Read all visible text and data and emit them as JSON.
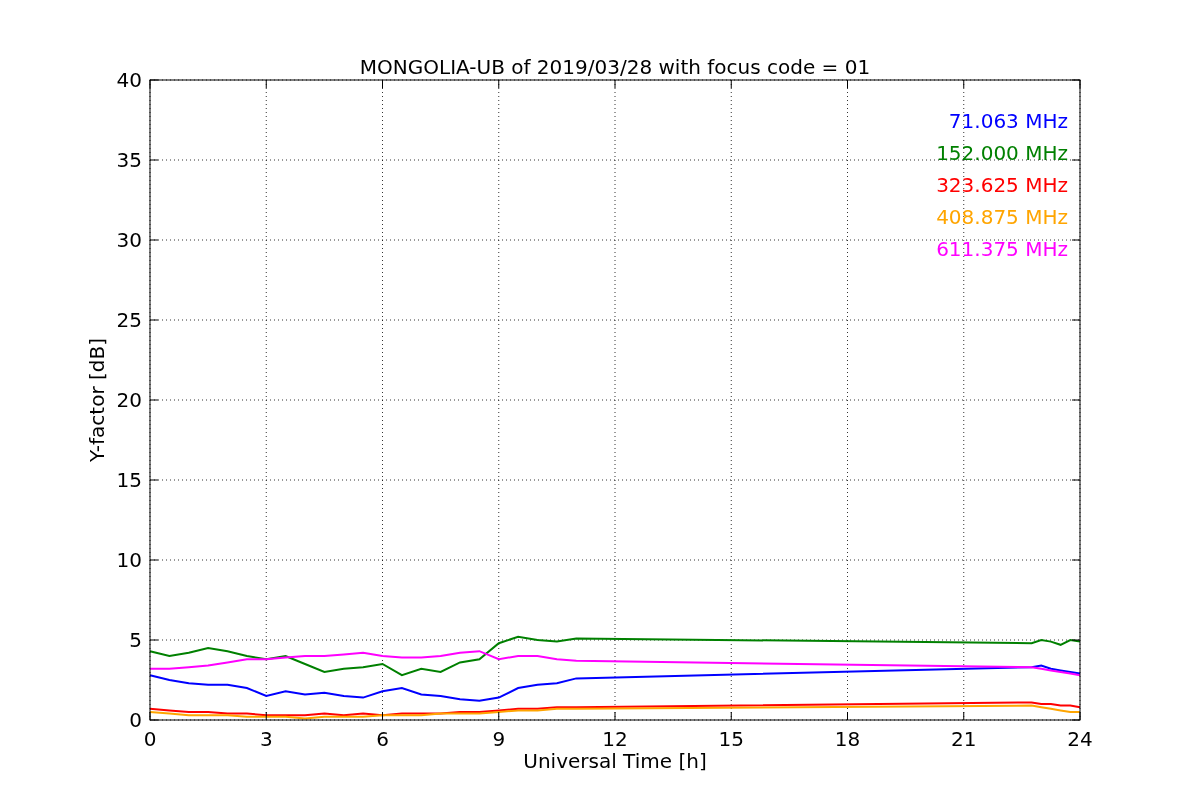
{
  "figure": {
    "chart_data": {
      "type": "line",
      "title": "MONGOLIA-UB of 2019/03/28 with focus code = 01",
      "xlabel": "Universal Time [h]",
      "ylabel": "Y-factor [dB]",
      "x": [
        0,
        0.5,
        1,
        1.5,
        2,
        2.5,
        3,
        3.5,
        4,
        4.5,
        5,
        5.5,
        6,
        6.5,
        7,
        7.5,
        8,
        8.5,
        9,
        9.5,
        10,
        10.5,
        11,
        22.75,
        23,
        23.25,
        23.5,
        23.75,
        24
      ],
      "series": [
        {
          "name": "71.063 MHz",
          "color": "#0000ff",
          "values": [
            2.8,
            2.5,
            2.3,
            2.2,
            2.2,
            2.0,
            1.5,
            1.8,
            1.6,
            1.7,
            1.5,
            1.4,
            1.8,
            2.0,
            1.6,
            1.5,
            1.3,
            1.2,
            1.4,
            2.0,
            2.2,
            2.3,
            2.6,
            3.3,
            3.4,
            3.2,
            3.1,
            3.0,
            2.9
          ]
        },
        {
          "name": "152.000 MHz",
          "color": "#008000",
          "values": [
            4.3,
            4.0,
            4.2,
            4.5,
            4.3,
            4.0,
            3.8,
            4.0,
            3.5,
            3.0,
            3.2,
            3.3,
            3.5,
            2.8,
            3.2,
            3.0,
            3.6,
            3.8,
            4.8,
            5.2,
            5.0,
            4.9,
            5.1,
            4.8,
            5.0,
            4.9,
            4.7,
            5.0,
            4.9
          ]
        },
        {
          "name": "323.625 MHz",
          "color": "#ff0000",
          "values": [
            0.7,
            0.6,
            0.5,
            0.5,
            0.4,
            0.4,
            0.3,
            0.3,
            0.3,
            0.4,
            0.3,
            0.4,
            0.3,
            0.4,
            0.4,
            0.4,
            0.5,
            0.5,
            0.6,
            0.7,
            0.7,
            0.8,
            0.8,
            1.1,
            1.0,
            1.0,
            0.9,
            0.9,
            0.8
          ]
        },
        {
          "name": "408.875 MHz",
          "color": "#ffa500",
          "values": [
            0.5,
            0.4,
            0.3,
            0.3,
            0.3,
            0.2,
            0.2,
            0.2,
            0.1,
            0.2,
            0.2,
            0.2,
            0.3,
            0.3,
            0.3,
            0.4,
            0.4,
            0.4,
            0.5,
            0.6,
            0.6,
            0.7,
            0.7,
            0.9,
            0.8,
            0.7,
            0.6,
            0.5,
            0.5
          ]
        },
        {
          "name": "611.375 MHz",
          "color": "#ff00ff",
          "values": [
            3.2,
            3.2,
            3.3,
            3.4,
            3.6,
            3.8,
            3.8,
            3.9,
            4.0,
            4.0,
            4.1,
            4.2,
            4.0,
            3.9,
            3.9,
            4.0,
            4.2,
            4.3,
            3.8,
            4.0,
            4.0,
            3.8,
            3.7,
            3.3,
            3.2,
            3.1,
            3.0,
            2.9,
            2.8
          ]
        }
      ],
      "grid": true,
      "xlim": [
        0,
        24
      ],
      "ylim": [
        0,
        40
      ],
      "xticks": [
        0,
        3,
        6,
        9,
        12,
        15,
        18,
        21,
        24
      ],
      "yticks": [
        0,
        5,
        10,
        15,
        20,
        25,
        30,
        35,
        40
      ]
    }
  }
}
